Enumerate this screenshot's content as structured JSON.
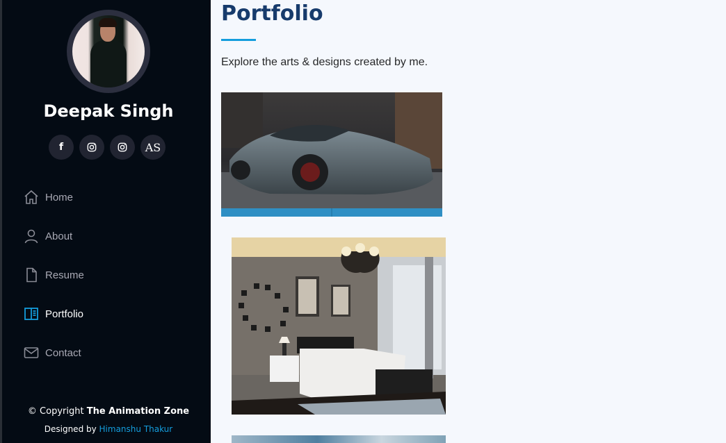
{
  "sidebar": {
    "profile_name": "Deepak Singh",
    "social": [
      {
        "icon": "facebook-icon",
        "glyph": "f"
      },
      {
        "icon": "instagram-icon"
      },
      {
        "icon": "instagram-icon"
      },
      {
        "icon": "as-logo-icon",
        "label": "AS"
      }
    ],
    "nav": [
      {
        "label": "Home",
        "icon": "home-icon",
        "active": false
      },
      {
        "label": "About",
        "icon": "person-icon",
        "active": false
      },
      {
        "label": "Resume",
        "icon": "file-icon",
        "active": false
      },
      {
        "label": "Portfolio",
        "icon": "book-half-icon",
        "active": true
      },
      {
        "label": "Contact",
        "icon": "envelope-icon",
        "active": false
      }
    ],
    "footer": {
      "copyright_prefix": "© Copyright ",
      "copyright_brand": "The Animation Zone",
      "designed_prefix": "Designed by ",
      "designer": "Himanshu Thakur"
    }
  },
  "main": {
    "title": "Portfolio",
    "subtitle": "Explore the arts & designs created by me."
  },
  "colors": {
    "sidebar_bg": "#040b14",
    "accent": "#149ddd",
    "title": "#173b6c",
    "page_bg": "#f5f8fd"
  }
}
